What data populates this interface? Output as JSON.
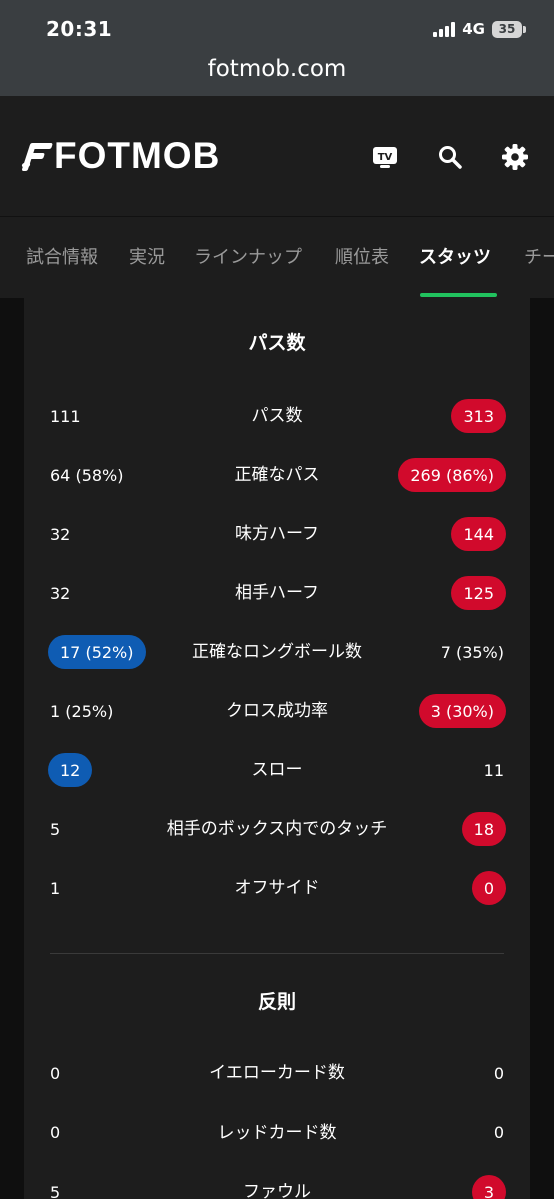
{
  "status_bar": {
    "time": "20:31",
    "network": "4G",
    "battery": "35"
  },
  "browser": {
    "url": "fotmob.com"
  },
  "header": {
    "logo": "FOTMOB",
    "icons": [
      "tv-icon",
      "search-icon",
      "settings-gear-icon"
    ],
    "tv_label": "TV"
  },
  "tabs": [
    {
      "label": "試合情報",
      "active": false
    },
    {
      "label": "実況",
      "active": false
    },
    {
      "label": "ラインナップ",
      "active": false
    },
    {
      "label": "順位表",
      "active": false
    },
    {
      "label": "スタッツ",
      "active": true
    },
    {
      "label": "チー",
      "active": false
    }
  ],
  "colors": {
    "home_highlight": "#0f5cb3",
    "away_highlight": "#d10a2c",
    "active_tab_indicator": "#21c25e"
  },
  "passes": {
    "title": "パス数",
    "rows": [
      {
        "label": "パス数",
        "home": "111",
        "away": "313",
        "highlight": "away"
      },
      {
        "label": "正確なパス",
        "home": "64 (58%)",
        "away": "269 (86%)",
        "highlight": "away"
      },
      {
        "label": "味方ハーフ",
        "home": "32",
        "away": "144",
        "highlight": "away"
      },
      {
        "label": "相手ハーフ",
        "home": "32",
        "away": "125",
        "highlight": "away"
      },
      {
        "label": "正確なロングボール数",
        "home": "17 (52%)",
        "away": "7 (35%)",
        "highlight": "home"
      },
      {
        "label": "クロス成功率",
        "home": "1 (25%)",
        "away": "3 (30%)",
        "highlight": "away"
      },
      {
        "label": "スロー",
        "home": "12",
        "away": "11",
        "highlight": "home"
      },
      {
        "label": "相手のボックス内でのタッチ",
        "home": "5",
        "away": "18",
        "highlight": "away"
      },
      {
        "label": "オフサイド",
        "home": "1",
        "away": "0",
        "highlight": "away"
      }
    ]
  },
  "fouls": {
    "title": "反則",
    "rows": [
      {
        "label": "イエローカード数",
        "home": "0",
        "away": "0",
        "highlight": "none"
      },
      {
        "label": "レッドカード数",
        "home": "0",
        "away": "0",
        "highlight": "none"
      },
      {
        "label": "ファウル",
        "home": "5",
        "away": "3",
        "highlight": "away"
      }
    ]
  }
}
